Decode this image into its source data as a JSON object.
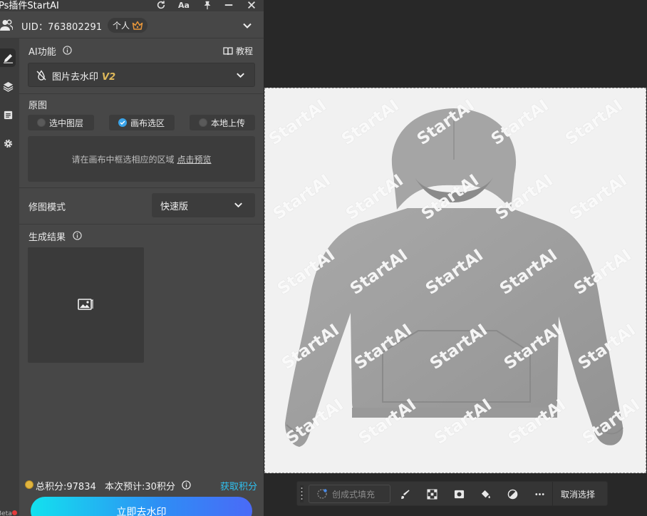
{
  "titlebar": {
    "title": "Ps插件StartAI",
    "icons": [
      "refresh-icon",
      "font-size-icon",
      "pin-icon",
      "minimize-icon",
      "close-icon"
    ],
    "font_size_label": "Aa"
  },
  "user": {
    "uid_label": "UID：763802291",
    "plan_label": "个人"
  },
  "ai_function": {
    "label": "AI功能",
    "tutorial_label": "教程",
    "selected_function": "图片去水印",
    "version": "V2"
  },
  "source": {
    "label": "原图",
    "options": [
      {
        "label": "选中图层",
        "checked": false
      },
      {
        "label": "画布选区",
        "checked": true
      },
      {
        "label": "本地上传",
        "checked": false
      }
    ],
    "hint": "请在画布中框选相应的区域",
    "hint_link": "点击预览"
  },
  "mode": {
    "label": "修图模式",
    "value": "快速版"
  },
  "result": {
    "label": "生成结果"
  },
  "footer": {
    "points": "总积分:97834",
    "estimate": "本次预计:30积分",
    "get_points": "获取积分",
    "action": "立即去水印",
    "beta": "Beta"
  },
  "canvas": {
    "watermark_text": "StartAI",
    "watermarks": [
      1,
      2,
      3,
      4,
      5,
      6,
      7,
      8,
      9,
      10,
      11,
      12,
      13,
      14,
      15,
      16,
      17,
      18,
      19,
      20,
      21,
      22,
      23,
      24,
      25
    ]
  },
  "toolbar": {
    "generative_fill": "创成式填充",
    "deselect": "取消选择",
    "tools": [
      "brush-icon",
      "pixel-icon",
      "mask-icon",
      "bucket-icon",
      "contrast-icon",
      "more-icon"
    ]
  },
  "colors": {
    "panel_bg": "#474747",
    "accent_blue": "#2fc1f0",
    "checked_blue": "#3aa3e8",
    "version_gold": "#e0b95a",
    "crown_orange": "#e9973a"
  }
}
